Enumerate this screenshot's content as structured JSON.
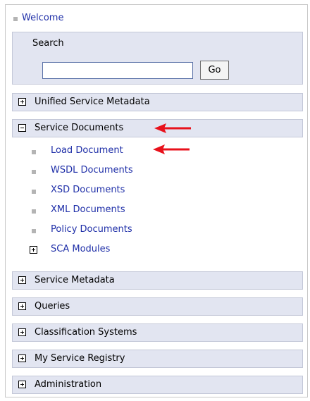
{
  "nav": {
    "welcome": "Welcome",
    "search_title": "Search",
    "search_value": "",
    "go_label": "Go",
    "sections": [
      "Unified Service Metadata",
      "Service Documents",
      "Service Metadata",
      "Queries",
      "Classification Systems",
      "My Service Registry",
      "Administration"
    ],
    "service_documents_items": [
      "Load Document",
      "WSDL Documents",
      "XSD Documents",
      "XML Documents",
      "Policy Documents"
    ],
    "sca_modules": "SCA Modules"
  },
  "colors": {
    "panel_bg": "#e2e5f1",
    "link": "#1f2fa8",
    "arrow": "#e8111b"
  }
}
